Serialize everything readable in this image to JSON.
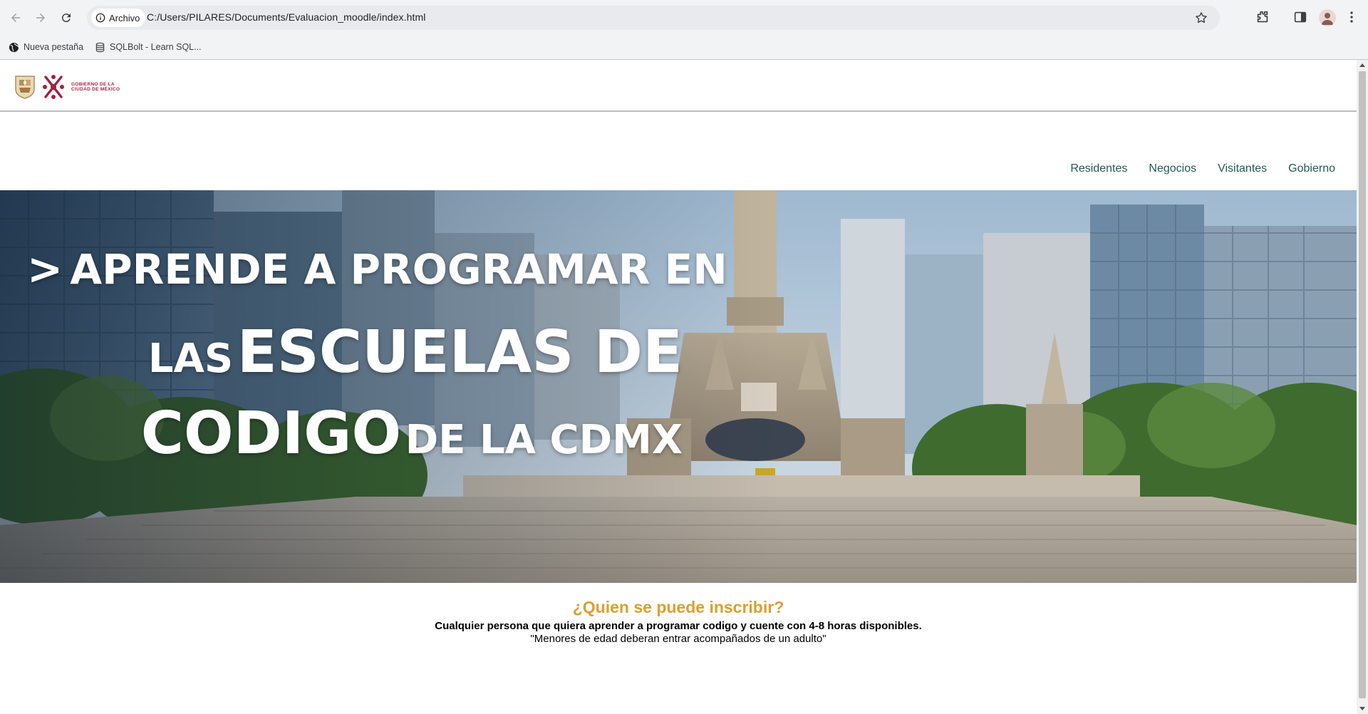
{
  "browser": {
    "site_chip": "Archivo",
    "url": "C:/Users/PILARES/Documents/Evaluacion_moodle/index.html",
    "bookmarks": [
      {
        "label": "Nueva pestaña",
        "icon": "globe-icon"
      },
      {
        "label": "SQLBolt - Learn SQL...",
        "icon": "database-icon"
      }
    ]
  },
  "header": {
    "logo_text_line1": "GOBIERNO DE LA",
    "logo_text_line2": "CIUDAD DE MÉXICO"
  },
  "menu": [
    "Residentes",
    "Negocios",
    "Visitantes",
    "Gobierno"
  ],
  "hero": {
    "chevron": ">",
    "line1": "APRENDE A PROGRAMAR EN",
    "line2_small": "LAS",
    "line2_large": "ESCUELAS DE",
    "line3_large": "CODIGO",
    "line3_small": "DE LA CDMX"
  },
  "info": {
    "question": "¿Quien se puede inscribir?",
    "answer": "Cualquier persona que quiera aprender a programar codigo y cuente con 4-8 horas disponibles.",
    "note": "\"Menores de edad deberan entrar acompañados de un adulto\""
  },
  "colors": {
    "menu_link": "#235b4e",
    "question": "#dd9f2d",
    "brand": "#9f2241"
  }
}
